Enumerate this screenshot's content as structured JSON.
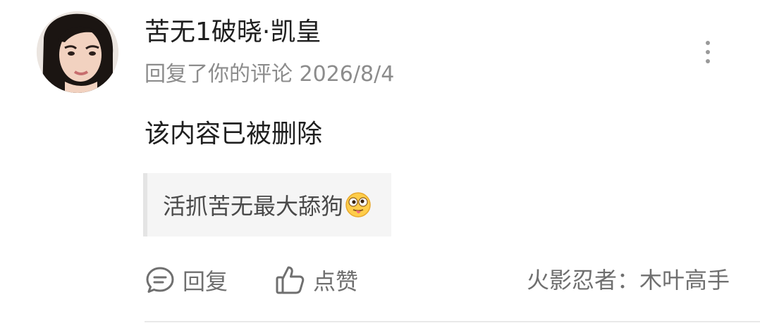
{
  "comment": {
    "username": "苦无1破晓·凯皇",
    "action_text": "回复了你的评论",
    "date": "2026/8/4",
    "content": "该内容已被删除",
    "quoted_text": "活抓苦无最大舔狗",
    "quoted_emoji": "tongue-out-emoji"
  },
  "actions": {
    "reply_label": "回复",
    "like_label": "点赞"
  },
  "source": {
    "text": "火影忍者：木叶高手"
  },
  "icons": {
    "more": "more-vertical-icon",
    "reply": "comment-bubble-icon",
    "like": "thumbs-up-icon"
  },
  "colors": {
    "primary_text": "#1f1f1f",
    "secondary_text": "#8c8c8c",
    "action_text": "#6f6f6f",
    "quote_bg": "#f5f5f5",
    "quote_bar": "#e4e4e4"
  }
}
